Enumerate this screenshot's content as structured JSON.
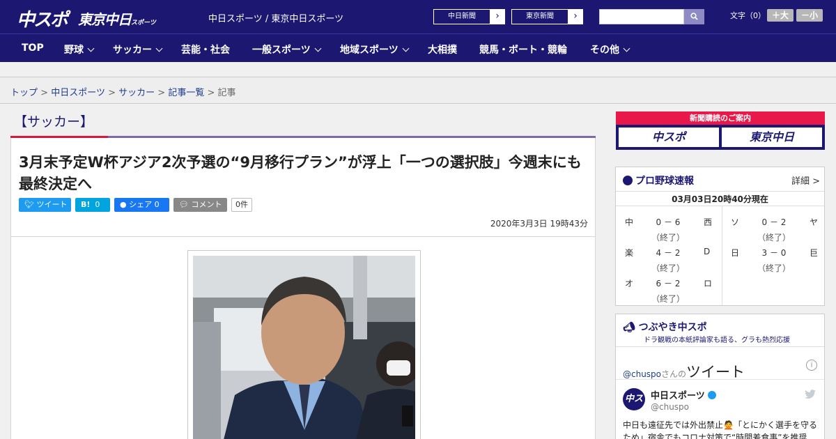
{
  "header": {
    "logo_chuspo": "中スポ",
    "logo_tokyo": "東京中日",
    "logo_tokyo_small": "スポーツ",
    "site_names": "中日スポーツ / 東京中日スポーツ",
    "ext_links": [
      "中日新聞",
      "東京新聞"
    ],
    "search_placeholder": "",
    "font_label": "文字（0）",
    "font_larger": "＋大",
    "font_smaller": "－小"
  },
  "nav": {
    "items": [
      {
        "label": "TOP",
        "dropdown": false
      },
      {
        "label": "野球",
        "dropdown": true
      },
      {
        "label": "サッカー",
        "dropdown": true
      },
      {
        "label": "芸能・社会",
        "dropdown": false
      },
      {
        "label": "一般スポーツ",
        "dropdown": true
      },
      {
        "label": "地域スポーツ",
        "dropdown": true
      },
      {
        "label": "大相撲",
        "dropdown": false
      },
      {
        "label": "競馬・ボート・競輪",
        "dropdown": false
      },
      {
        "label": "その他",
        "dropdown": true
      }
    ]
  },
  "breadcrumb": {
    "items": [
      "トップ",
      "中日スポーツ",
      "サッカー",
      "記事一覧"
    ],
    "current": "記事",
    "separator": ">"
  },
  "article": {
    "category": "【サッカー】",
    "headline": "3月末予定W杯アジア2次予選の“9月移行プラン”が浮上「一つの選択肢」今週末にも最終決定へ",
    "share": {
      "tweet": "ツイート",
      "hatena": "B!",
      "hatena_count": "0",
      "facebook": "シェア",
      "facebook_count": "0",
      "comment": "コメント",
      "comment_count": "0件"
    },
    "date": "2020年3月3日 19時43分"
  },
  "sidebar": {
    "subscribe_title": "新聞購読のご案内",
    "subscribe_logos": [
      "中スポ",
      "東京中日"
    ],
    "baseball": {
      "title": "プロ野球速報",
      "more": "詳細 >",
      "time": "03月03日20時40分現在",
      "games": [
        {
          "home": "中",
          "score": "0 － 6",
          "away": "西",
          "status": "（終了）"
        },
        {
          "home": "楽",
          "score": "4 － 2",
          "away": "D",
          "status": "（終了）"
        },
        {
          "home": "オ",
          "score": "6 － 2",
          "away": "ロ",
          "status": "（終了）"
        },
        {
          "home": "ソ",
          "score": "0 － 2",
          "away": "ヤ",
          "status": "（終了）"
        },
        {
          "home": "日",
          "score": "3 － 0",
          "away": "巨",
          "status": "（終了）"
        }
      ]
    },
    "tweets": {
      "title": "つぶやき中スポ",
      "subtitle": "ドラ観戦の本紙評論家も語る、グラも熱烈応援",
      "handle": "@chuspo",
      "handle_suffix": "さんの",
      "heading": "ツイート",
      "info": "i",
      "avatar": "中スポ",
      "account_name": "中日スポーツ",
      "account_at": "@chuspo",
      "text": "中日も遠征先では外出禁止🙅「とにかく選手を守るため」宿舎でもコロナ対策で“時間差食事”を推奨"
    }
  }
}
